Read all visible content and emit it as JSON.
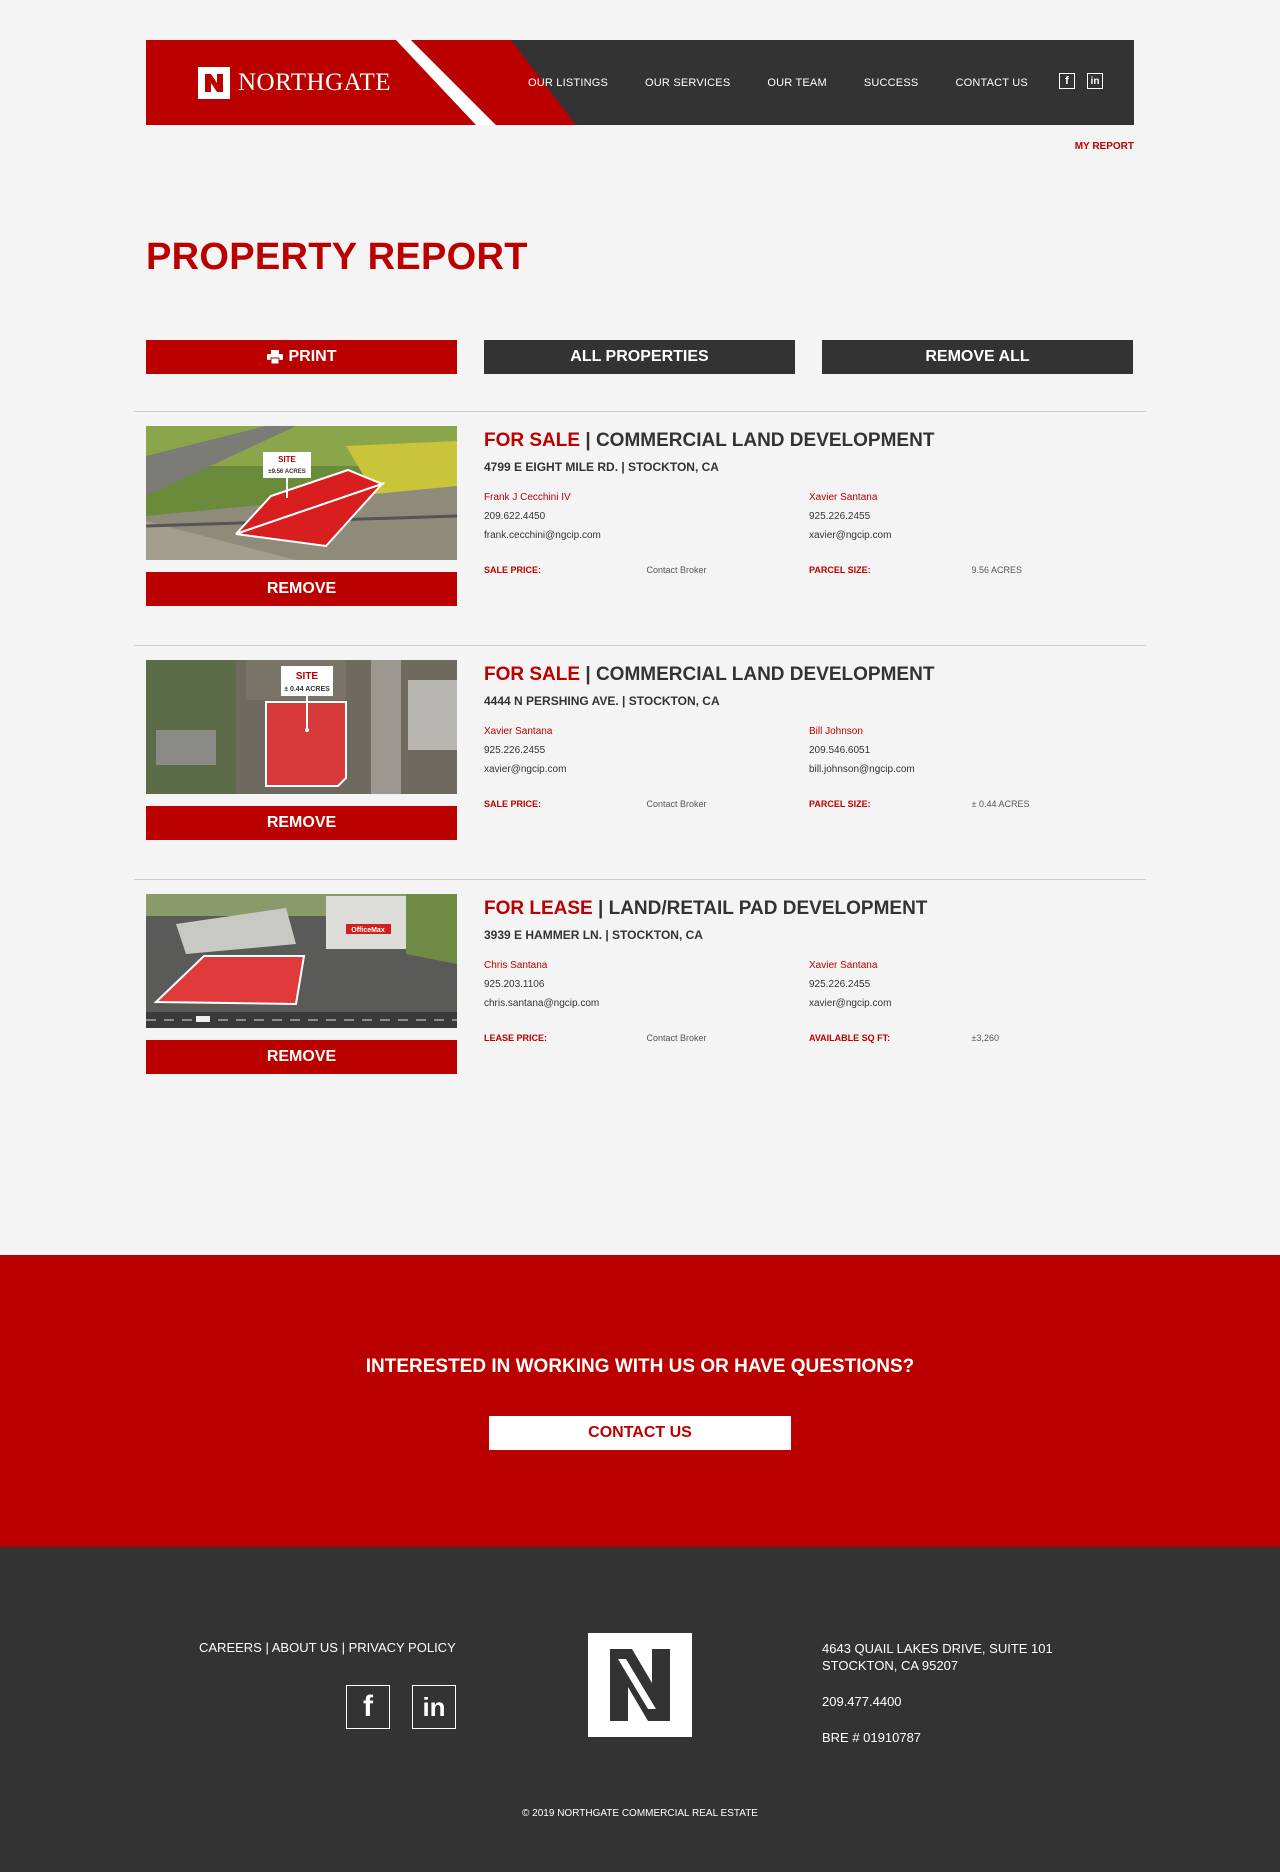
{
  "brand": {
    "name": "NORTHGATE",
    "accent": "#bb0000",
    "dark": "#333333"
  },
  "nav": [
    "OUR LISTINGS",
    "OUR SERVICES",
    "OUR TEAM",
    "SUCCESS",
    "CONTACT US"
  ],
  "header_social": [
    "facebook-icon",
    "linkedin-icon"
  ],
  "my_report": "MY REPORT",
  "page_title": "PROPERTY REPORT",
  "actions": {
    "print": "PRINT",
    "all": "ALL PROPERTIES",
    "remove_all": "REMOVE ALL"
  },
  "listings": [
    {
      "type": "FOR SALE",
      "category": "COMMERCIAL LAND DEVELOPMENT",
      "address": "4799 E EIGHT MILE RD. | STOCKTON, CA",
      "image_sign": {
        "label": "SITE",
        "sub": "±9.56 ACRES"
      },
      "brokers": [
        {
          "name": "Frank J Cecchini IV",
          "phone": "209.622.4450",
          "email": "frank.cecchini@ngcip.com"
        },
        {
          "name": "Xavier Santana",
          "phone": "925.226.2455",
          "email": "xavier@ngcip.com"
        }
      ],
      "price_label": "SALE PRICE:",
      "price_value": "Contact Broker",
      "size_label": "PARCEL SIZE:",
      "size_value": "9.56 ACRES",
      "remove": "REMOVE"
    },
    {
      "type": "FOR SALE",
      "category": "COMMERCIAL LAND DEVELOPMENT",
      "address": "4444 N PERSHING AVE. | STOCKTON, CA",
      "image_sign": {
        "label": "SITE",
        "sub": "± 0.44 ACRES"
      },
      "brokers": [
        {
          "name": "Xavier Santana",
          "phone": "925.226.2455",
          "email": "xavier@ngcip.com"
        },
        {
          "name": "Bill Johnson",
          "phone": "209.546.6051",
          "email": "bill.johnson@ngcip.com"
        }
      ],
      "price_label": "SALE PRICE:",
      "price_value": "Contact Broker",
      "size_label": "PARCEL SIZE:",
      "size_value": "± 0.44 ACRES",
      "remove": "REMOVE"
    },
    {
      "type": "FOR LEASE",
      "category": "LAND/RETAIL PAD DEVELOPMENT",
      "address": "3939 E HAMMER LN. | STOCKTON, CA",
      "image_sign": {
        "label": "OfficeMax",
        "sub": ""
      },
      "brokers": [
        {
          "name": "Chris Santana",
          "phone": "925.203.1106",
          "email": "chris.santana@ngcip.com"
        },
        {
          "name": "Xavier Santana",
          "phone": "925.226.2455",
          "email": "xavier@ngcip.com"
        }
      ],
      "price_label": "LEASE PRICE:",
      "price_value": "Contact Broker",
      "size_label": "AVAILABLE SQ FT:",
      "size_value": "±3,260",
      "remove": "REMOVE"
    }
  ],
  "cta": {
    "question": "INTERESTED IN WORKING WITH US OR HAVE QUESTIONS?",
    "button": "CONTACT US"
  },
  "footer": {
    "links": [
      "CAREERS",
      "ABOUT US",
      "PRIVACY POLICY"
    ],
    "address_line1": "4643 QUAIL LAKES DRIVE, SUITE 101",
    "address_line2": "STOCKTON, CA 95207",
    "phone": "209.477.4400",
    "bre": "BRE # 01910787",
    "copyright": "© 2019 NORTHGATE COMMERCIAL REAL ESTATE"
  }
}
